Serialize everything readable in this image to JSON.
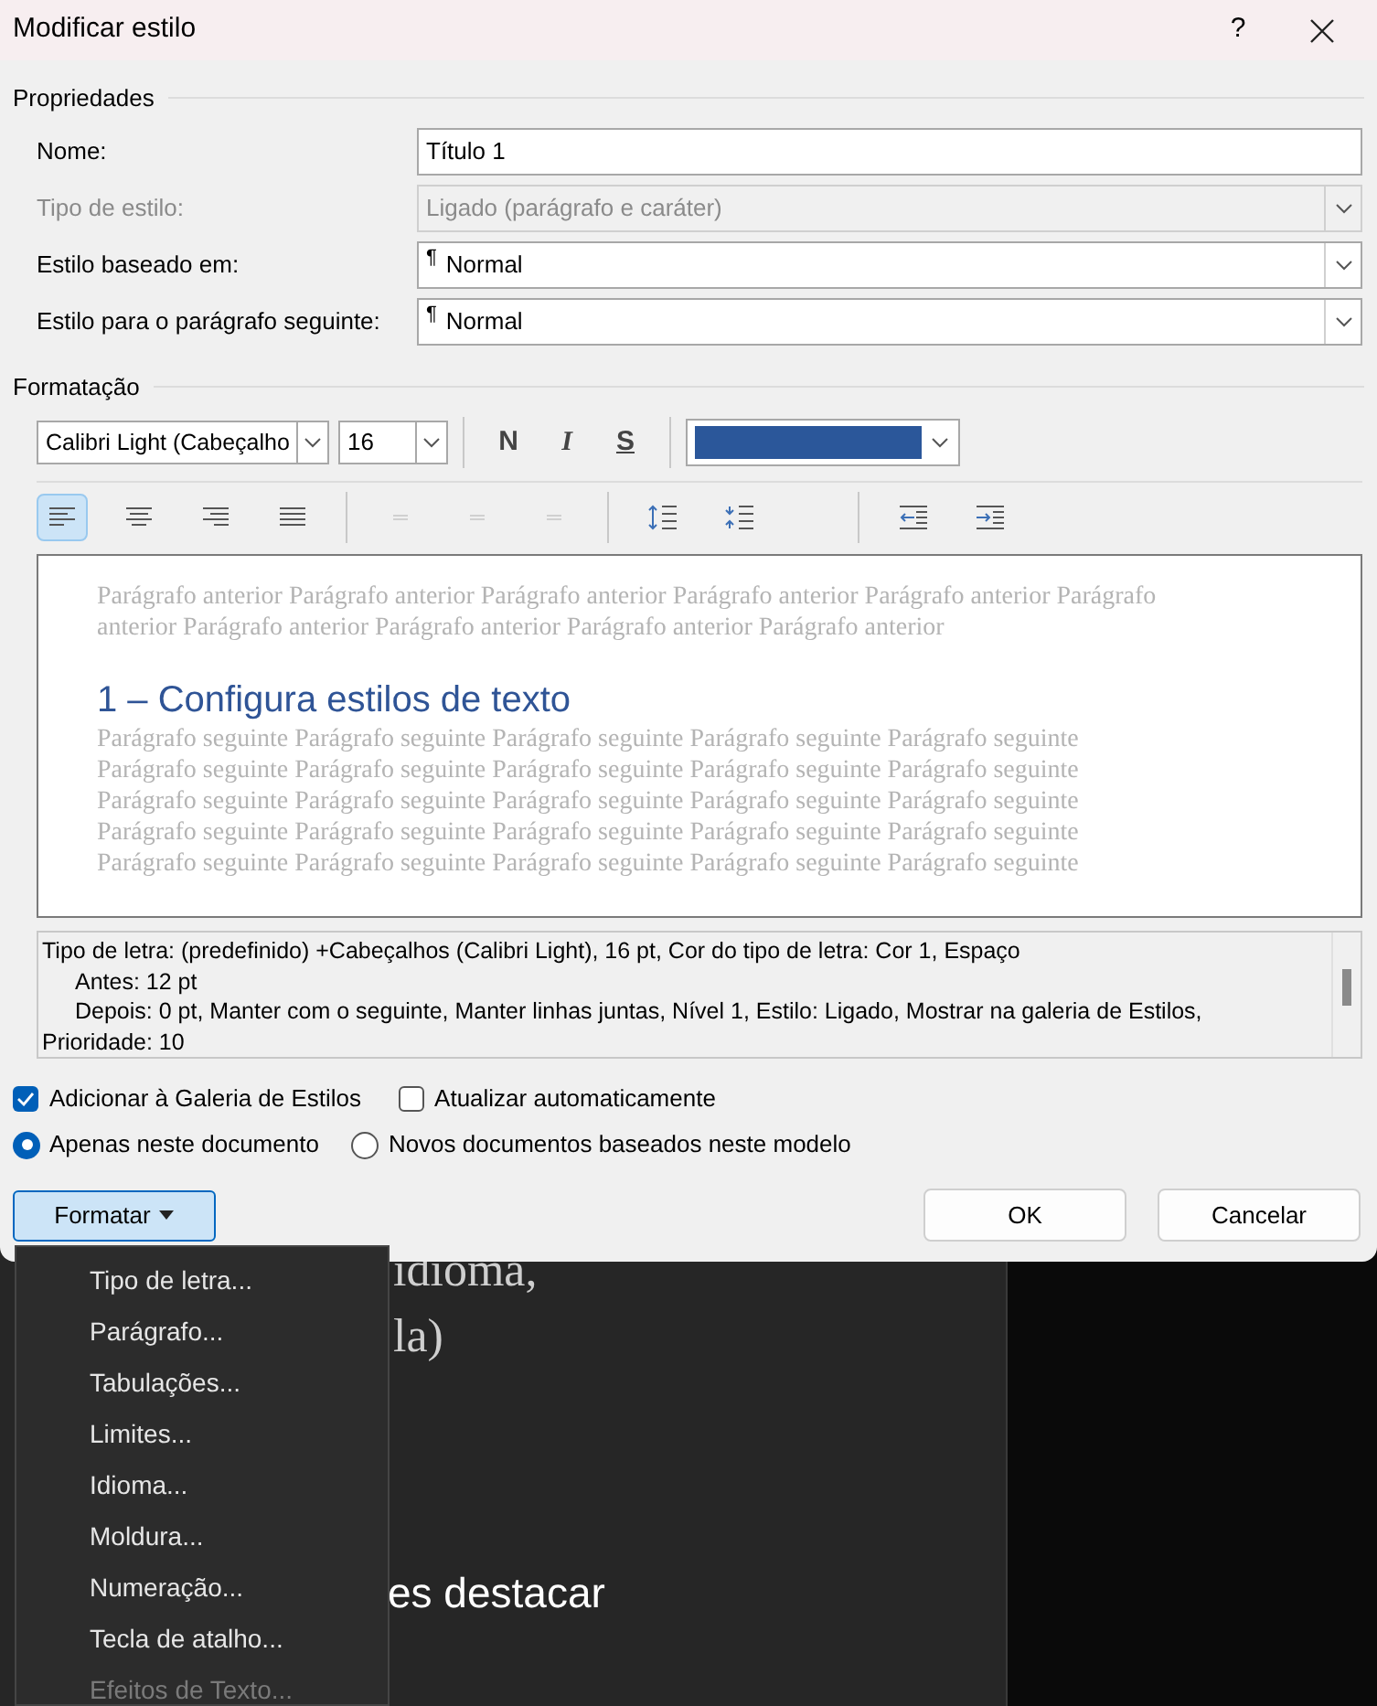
{
  "window": {
    "title": "Modificar estilo",
    "help": "?"
  },
  "properties": {
    "heading": "Propriedades",
    "rows": [
      {
        "label": "Nome:",
        "kind": "text",
        "value": "Título 1",
        "disabled": false
      },
      {
        "label": "Tipo de estilo:",
        "kind": "select",
        "value": "Ligado (parágrafo e caráter)",
        "disabled": true
      },
      {
        "label": "Estilo baseado em:",
        "kind": "select",
        "value": "Normal",
        "pilcrow": "¶",
        "disabled": false
      },
      {
        "label": "Estilo para o parágrafo seguinte:",
        "kind": "select",
        "value": "Normal",
        "pilcrow": "¶",
        "disabled": false
      }
    ]
  },
  "formatting": {
    "heading": "Formatação",
    "font": "Calibri Light (Cabeçalho",
    "size": "16",
    "styles": [
      "N",
      "I",
      "S"
    ],
    "color_picker": {
      "color": "#2b579a"
    },
    "paragraph_buttons": [
      {
        "kind": "align-left",
        "selected": true,
        "disabled": false
      },
      {
        "kind": "align-center",
        "selected": false,
        "disabled": false
      },
      {
        "kind": "align-right",
        "selected": false,
        "disabled": false
      },
      {
        "kind": "justify",
        "selected": false,
        "disabled": false
      },
      {
        "kind": "dash",
        "selected": false,
        "disabled": true
      },
      {
        "kind": "dash",
        "selected": false,
        "disabled": true
      },
      {
        "kind": "dash",
        "selected": false,
        "disabled": true
      },
      {
        "kind": "spacing-more",
        "selected": false,
        "disabled": false
      },
      {
        "kind": "spacing-less",
        "selected": false,
        "disabled": false
      },
      {
        "kind": "indent-less",
        "selected": false,
        "disabled": false
      },
      {
        "kind": "indent-more",
        "selected": false,
        "disabled": false
      }
    ]
  },
  "preview": {
    "previous": [
      "Parágrafo anterior Parágrafo anterior Parágrafo anterior Parágrafo anterior Parágrafo anterior Parágrafo",
      "anterior Parágrafo anterior Parágrafo anterior Parágrafo anterior Parágrafo anterior"
    ],
    "heading": "1 – Configura estilos de texto",
    "following": [
      "Parágrafo seguinte Parágrafo seguinte Parágrafo seguinte Parágrafo seguinte Parágrafo seguinte",
      "Parágrafo seguinte Parágrafo seguinte Parágrafo seguinte Parágrafo seguinte Parágrafo seguinte",
      "Parágrafo seguinte Parágrafo seguinte Parágrafo seguinte Parágrafo seguinte Parágrafo seguinte",
      "Parágrafo seguinte Parágrafo seguinte Parágrafo seguinte Parágrafo seguinte Parágrafo seguinte",
      "Parágrafo seguinte Parágrafo seguinte Parágrafo seguinte Parágrafo seguinte Parágrafo seguinte"
    ]
  },
  "description": [
    {
      "text": "Tipo de letra: (predefinido) +Cabeçalhos (Calibri Light), 16 pt, Cor do tipo de letra: Cor 1, Espaço",
      "indent": false
    },
    {
      "text": "Antes:  12 pt",
      "indent": true
    },
    {
      "text": "Depois:  0 pt, Manter com o seguinte, Manter linhas juntas, Nível 1, Estilo: Ligado, Mostrar na galeria de Estilos,",
      "indent": true
    },
    {
      "text": "Prioridade: 10",
      "indent": false
    }
  ],
  "checkboxes": [
    {
      "label": "Adicionar à Galeria de Estilos",
      "checked": true
    },
    {
      "label": "Atualizar automaticamente",
      "checked": false
    }
  ],
  "radios": [
    {
      "label": "Apenas neste documento",
      "selected": true
    },
    {
      "label": "Novos documentos baseados neste modelo",
      "selected": false
    }
  ],
  "format_button": "Formatar",
  "buttons": [
    "OK",
    "Cancelar"
  ],
  "menu": [
    {
      "label": "Tipo de letra...",
      "disabled": false
    },
    {
      "label": "Parágrafo...",
      "disabled": false
    },
    {
      "label": "Tabulações...",
      "disabled": false
    },
    {
      "label": "Limites...",
      "disabled": false
    },
    {
      "label": "Idioma...",
      "disabled": false
    },
    {
      "label": "Moldura...",
      "disabled": false
    },
    {
      "label": "Numeração...",
      "disabled": false
    },
    {
      "label": "Tecla de atalho...",
      "disabled": false
    },
    {
      "label": "Efeitos de Texto...",
      "disabled": true
    }
  ],
  "background_text": [
    "idioma,",
    "la)",
    "es destacar"
  ]
}
